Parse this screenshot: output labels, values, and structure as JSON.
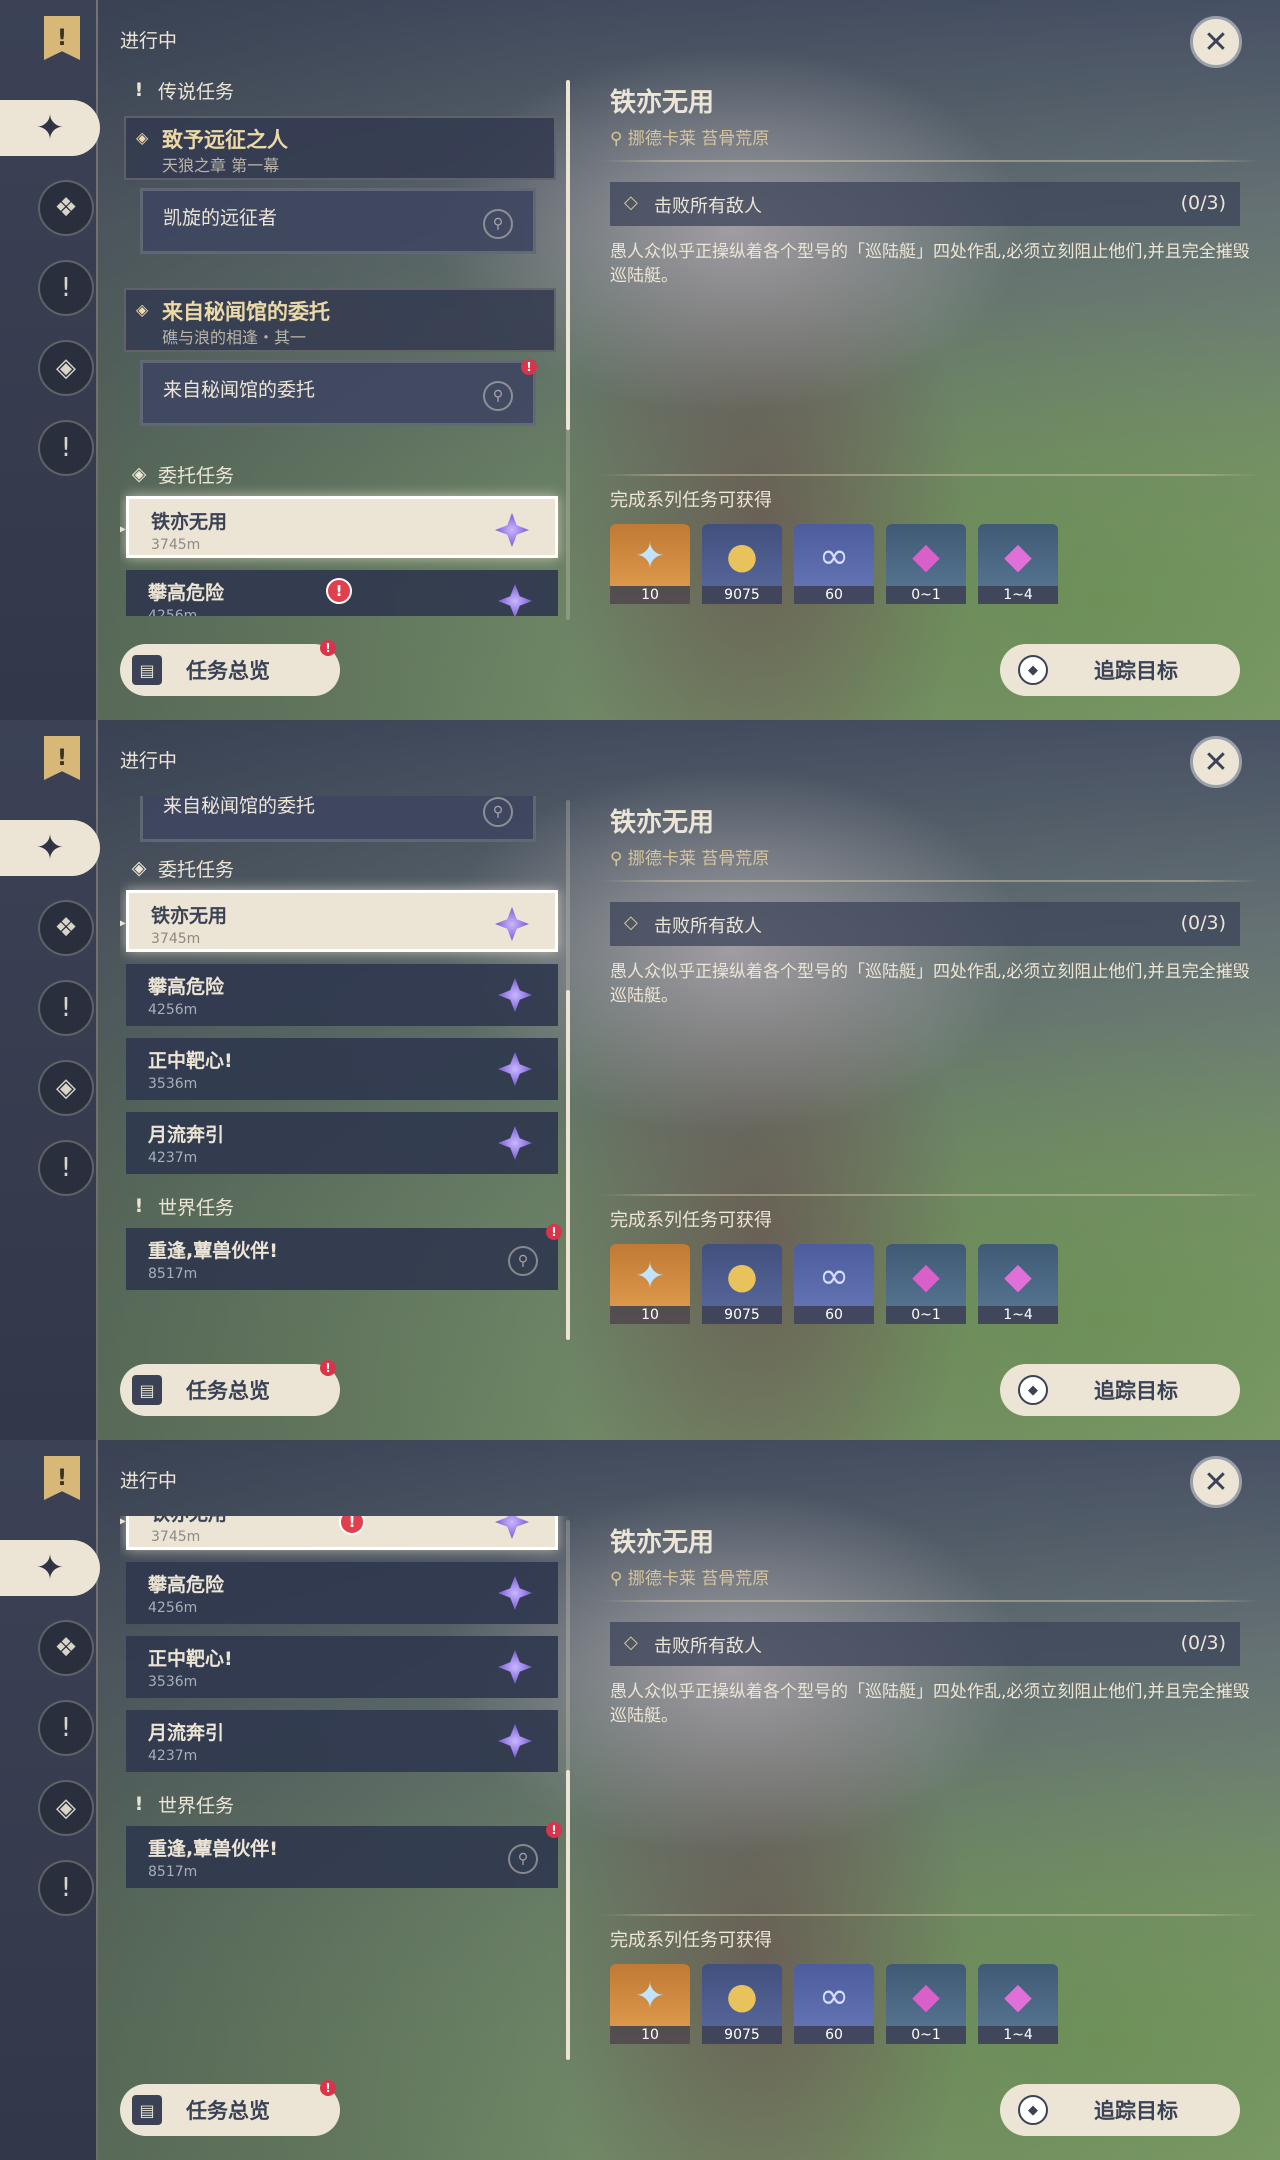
{
  "common": {
    "status": "进行中",
    "close": "✕",
    "overview_label": "任务总览",
    "track_label": "追踪目标",
    "badge": "!"
  },
  "categories": {
    "legend": "传说任务",
    "commission": "委托任务",
    "world": "世界任务"
  },
  "legend_chains": [
    {
      "title": "致予远征之人",
      "subtitle": "天狼之章 第一幕",
      "sub": "凯旋的远征者"
    },
    {
      "title": "来自秘闻馆的委托",
      "subtitle": "礁与浪的相逢・其一",
      "sub": "来自秘闻馆的委托"
    }
  ],
  "commissions": [
    {
      "title": "铁亦无用",
      "distance": "3745m"
    },
    {
      "title": "攀高危险",
      "distance": "4256m"
    },
    {
      "title": "正中靶心!",
      "distance": "3536m"
    },
    {
      "title": "月流奔引",
      "distance": "4237m"
    }
  ],
  "world_quests": [
    {
      "title": "重逢,蕈兽伙伴!",
      "distance": "8517m"
    }
  ],
  "detail": {
    "title": "铁亦无用",
    "location": "挪德卡莱 苔骨荒原",
    "objective": "击败所有敌人",
    "progress": "(0/3)",
    "description": "愚人众似乎正操纵着各个型号的「巡陆艇」四处作乱,必须立刻阻止他们,并且完全摧毁巡陆艇。",
    "rewards_label": "完成系列任务可获得",
    "rewards": [
      {
        "name": "primogem-icon",
        "qty": "10",
        "color": "#d98a3a",
        "glyph": "✦"
      },
      {
        "name": "mora-icon",
        "qty": "9075",
        "color": "#4d5a8c",
        "glyph": "●"
      },
      {
        "name": "adventure-exp-icon",
        "qty": "60",
        "color": "#5a6aa8",
        "glyph": "∞"
      },
      {
        "name": "crystal-small-icon",
        "qty": "0~1",
        "color": "#4f6e88",
        "glyph": "◆"
      },
      {
        "name": "crystal-large-icon",
        "qty": "1~4",
        "color": "#4f6e88",
        "glyph": "◆"
      }
    ]
  },
  "colors": {
    "accent": "#ece5d5",
    "gold": "#d8c69a",
    "panel": "#323849",
    "alert": "#e0404e"
  }
}
